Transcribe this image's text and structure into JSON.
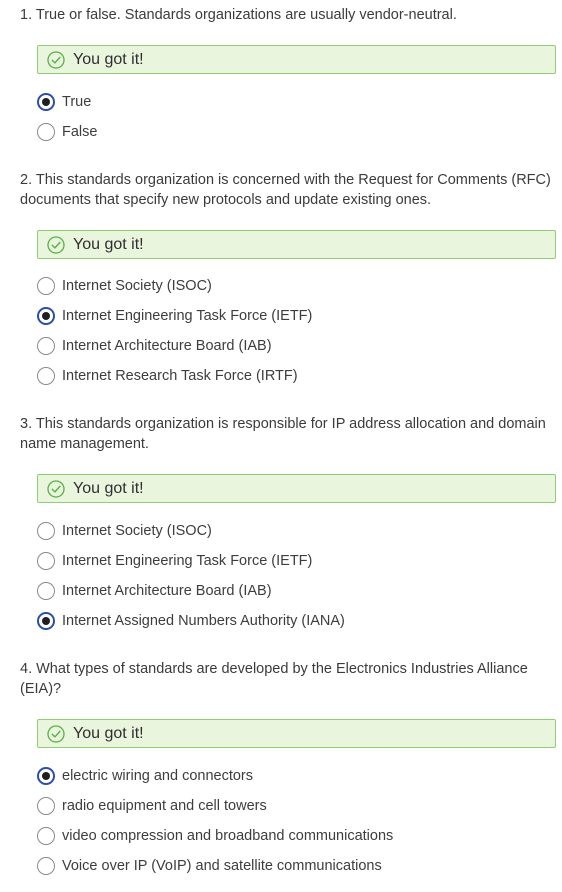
{
  "colors": {
    "feedback_bg": "#e9f5dd",
    "feedback_border": "#8fcf70",
    "check_icon": "#58b046",
    "radio_selected": "#2b4fa8",
    "text": "#3b3b3b"
  },
  "questions": [
    {
      "number": "1.",
      "text": "True or false. Standards organizations are usually vendor-neutral.",
      "feedback": "You got it!",
      "feedback_icon": "check-circle-icon",
      "options": [
        {
          "label": "True",
          "selected": true
        },
        {
          "label": "False",
          "selected": false
        }
      ]
    },
    {
      "number": "2.",
      "text": "This standards organization is concerned with the Request for Comments (RFC) documents that specify new protocols and update existing ones.",
      "feedback": "You got it!",
      "feedback_icon": "check-circle-icon",
      "options": [
        {
          "label": "Internet Society (ISOC)",
          "selected": false
        },
        {
          "label": "Internet Engineering Task Force (IETF)",
          "selected": true
        },
        {
          "label": "Internet Architecture Board (IAB)",
          "selected": false
        },
        {
          "label": "Internet Research Task Force (IRTF)",
          "selected": false
        }
      ]
    },
    {
      "number": "3.",
      "text": "This standards organization is responsible for IP address allocation and domain name management.",
      "feedback": "You got it!",
      "feedback_icon": "check-circle-icon",
      "options": [
        {
          "label": "Internet Society (ISOC)",
          "selected": false
        },
        {
          "label": "Internet Engineering Task Force (IETF)",
          "selected": false
        },
        {
          "label": "Internet Architecture Board (IAB)",
          "selected": false
        },
        {
          "label": "Internet Assigned Numbers Authority (IANA)",
          "selected": true
        }
      ]
    },
    {
      "number": "4.",
      "text": "What types of standards are developed by the Electronics Industries Alliance (EIA)?",
      "feedback": "You got it!",
      "feedback_icon": "check-circle-icon",
      "options": [
        {
          "label": "electric wiring and connectors",
          "selected": true
        },
        {
          "label": "radio equipment and cell towers",
          "selected": false
        },
        {
          "label": "video compression and broadband communications",
          "selected": false
        },
        {
          "label": "Voice over IP (VoIP) and satellite communications",
          "selected": false
        }
      ]
    }
  ]
}
